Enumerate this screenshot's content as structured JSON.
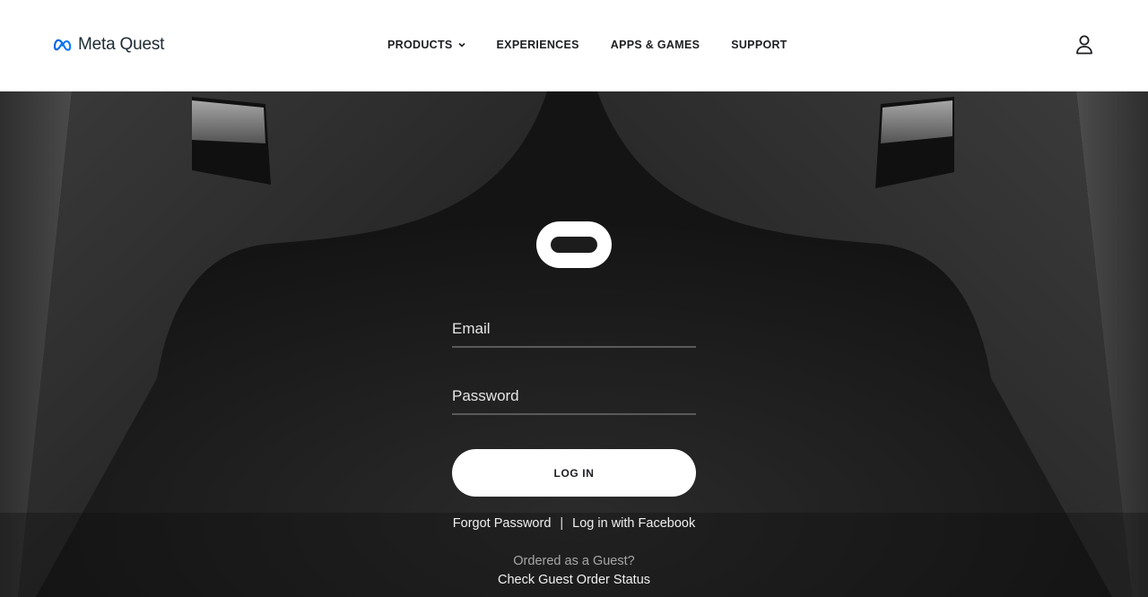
{
  "header": {
    "logo_text": "Meta Quest",
    "logo_icon": "meta-infinity-icon",
    "nav": [
      {
        "label": "PRODUCTS",
        "has_dropdown": true
      },
      {
        "label": "EXPERIENCES"
      },
      {
        "label": "APPS & GAMES"
      },
      {
        "label": "SUPPORT"
      }
    ],
    "account_icon": "user-icon"
  },
  "login": {
    "brand_icon": "oculus-logo-icon",
    "email_placeholder": "Email",
    "password_placeholder": "Password",
    "submit_label": "LOG IN",
    "forgot_password": "Forgot Password",
    "separator": "|",
    "facebook_login": "Log in with Facebook",
    "guest_question": "Ordered as a Guest?",
    "guest_status": "Check Guest Order Status"
  },
  "colors": {
    "header_bg": "#ffffff",
    "hero_bg": "#1b1b1b",
    "meta_blue": "#0668e1",
    "button_bg": "#ffffff",
    "text_dark": "#1c1e21"
  }
}
